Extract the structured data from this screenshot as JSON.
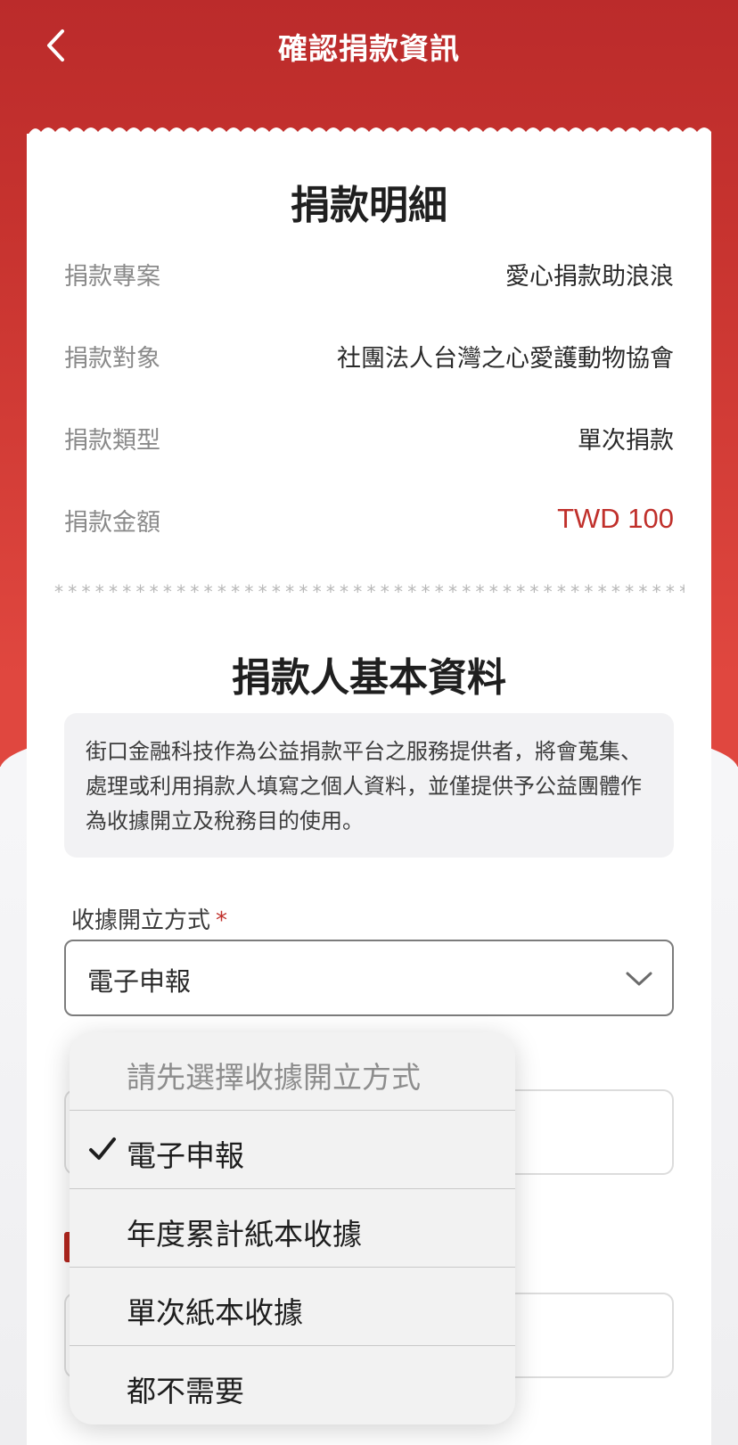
{
  "header": {
    "title": "確認捐款資訊",
    "background": "#bb2b2b"
  },
  "donation_detail": {
    "title": "捐款明細",
    "rows": [
      {
        "label": "捐款專案",
        "value": "愛心捐款助浪浪"
      },
      {
        "label": "捐款對象",
        "value": "社團法人台灣之心愛護動物協會"
      },
      {
        "label": "捐款類型",
        "value": "單次捐款"
      },
      {
        "label": "捐款金額",
        "value": "TWD 100"
      }
    ],
    "separator": "**************************************************"
  },
  "donor_info": {
    "title": "捐款人基本資料",
    "notice": "街口金融科技作為公益捐款平台之服務提供者，將會蒐集、處理或利用捐款人填寫之個人資料，並僅提供予公益團體作為收據開立及稅務目的使用。",
    "receipt_field": {
      "label": "收據開立方式",
      "required_mark": "*",
      "selected": "電子申報"
    }
  },
  "dropdown": {
    "placeholder": "請先選擇收據開立方式",
    "options": [
      {
        "label": "電子申報",
        "checked": true
      },
      {
        "label": "年度累計紙本收據",
        "checked": false
      },
      {
        "label": "單次紙本收據",
        "checked": false
      },
      {
        "label": "都不需要",
        "checked": false
      }
    ]
  },
  "colors": {
    "accent": "#c0302b",
    "label_gray": "#8a8a8a"
  }
}
